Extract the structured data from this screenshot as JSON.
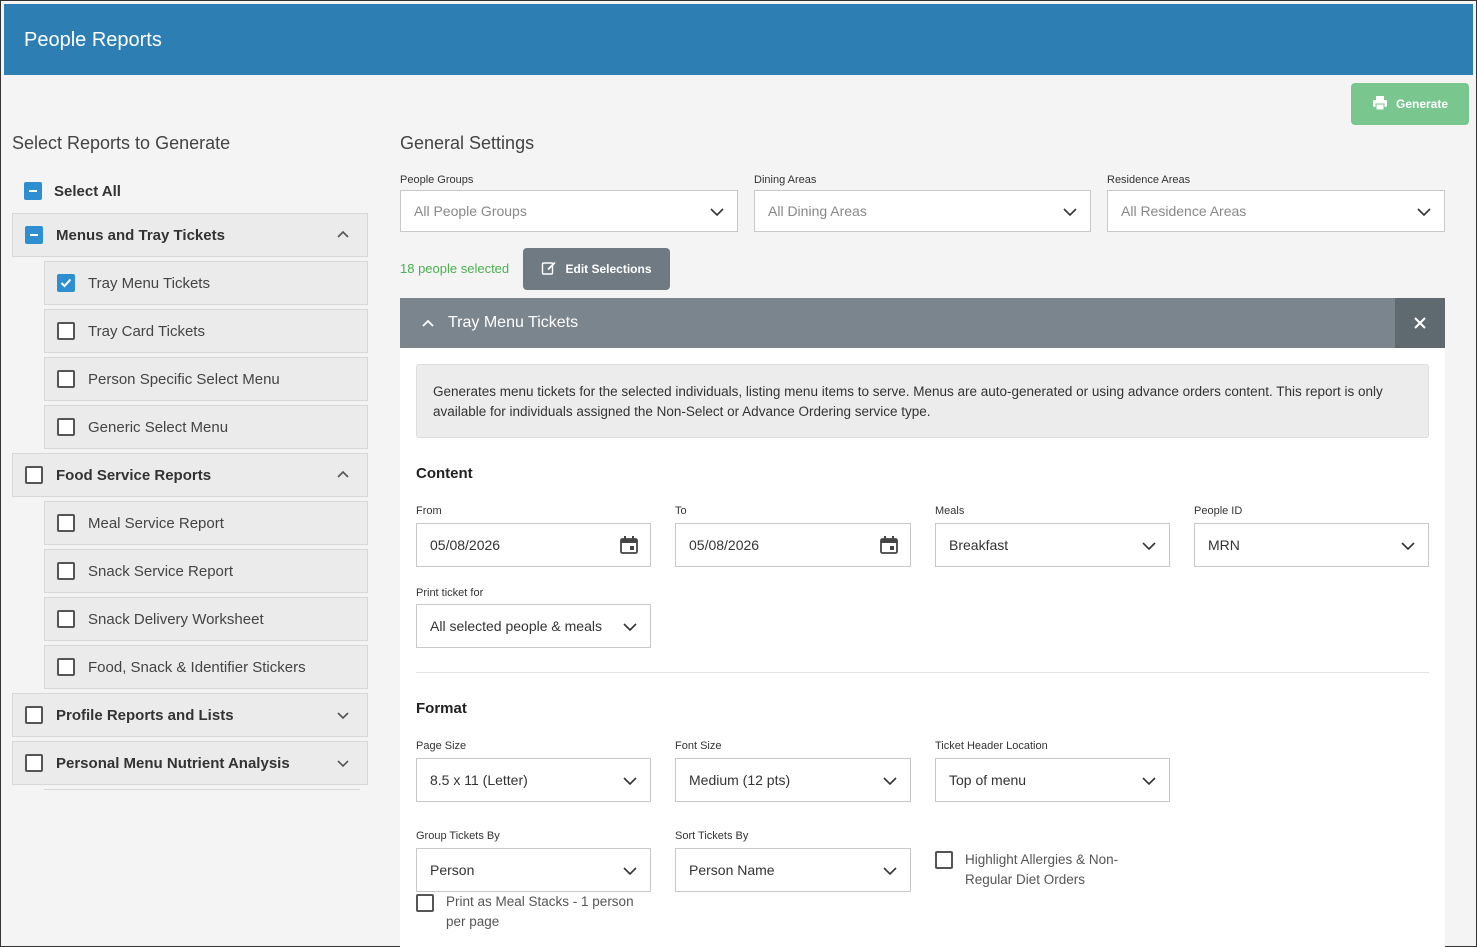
{
  "header": {
    "title": "People Reports"
  },
  "generate_label": "Generate",
  "left": {
    "heading": "Select Reports to Generate",
    "select_all": "Select All",
    "groups": [
      {
        "label": "Menus and Tray Tickets",
        "state": "partial",
        "expanded": true,
        "items": [
          {
            "label": "Tray Menu Tickets",
            "checked": true
          },
          {
            "label": "Tray Card Tickets",
            "checked": false
          },
          {
            "label": "Person Specific Select Menu",
            "checked": false
          },
          {
            "label": "Generic Select Menu",
            "checked": false
          }
        ]
      },
      {
        "label": "Food Service Reports",
        "state": "unchecked",
        "expanded": true,
        "items": [
          {
            "label": "Meal Service Report",
            "checked": false
          },
          {
            "label": "Snack Service Report",
            "checked": false
          },
          {
            "label": "Snack Delivery Worksheet",
            "checked": false
          },
          {
            "label": "Food, Snack & Identifier Stickers",
            "checked": false
          }
        ]
      },
      {
        "label": "Profile Reports and Lists",
        "state": "unchecked",
        "expanded": false,
        "items": []
      },
      {
        "label": "Personal Menu Nutrient Analysis",
        "state": "unchecked",
        "expanded": false,
        "items": []
      }
    ]
  },
  "general": {
    "heading": "General Settings",
    "people_groups": {
      "label": "People Groups",
      "value": "All People Groups"
    },
    "dining_areas": {
      "label": "Dining Areas",
      "value": "All Dining Areas"
    },
    "residence_areas": {
      "label": "Residence Areas",
      "value": "All Residence Areas"
    },
    "people_selected": "18 people selected",
    "edit_selections": "Edit Selections"
  },
  "panel": {
    "title": "Tray Menu Tickets",
    "description": "Generates menu tickets for the selected individuals, listing menu items to serve. Menus are auto-generated or using advance orders content. This report is only available for individuals assigned the Non-Select or Advance Ordering service type.",
    "content": {
      "heading": "Content",
      "from": {
        "label": "From",
        "value": "05/08/2026"
      },
      "to": {
        "label": "To",
        "value": "05/08/2026"
      },
      "meals": {
        "label": "Meals",
        "value": "Breakfast"
      },
      "people_id": {
        "label": "People ID",
        "value": "MRN"
      },
      "print_for": {
        "label": "Print ticket for",
        "value": "All selected people & meals"
      }
    },
    "format": {
      "heading": "Format",
      "page_size": {
        "label": "Page Size",
        "value": "8.5 x 11 (Letter)"
      },
      "font_size": {
        "label": "Font Size",
        "value": "Medium (12 pts)"
      },
      "header_location": {
        "label": "Ticket Header Location",
        "value": "Top of menu"
      },
      "group_by": {
        "label": "Group Tickets By",
        "value": "Person"
      },
      "sort_by": {
        "label": "Sort Tickets By",
        "value": "Person Name"
      },
      "highlight": {
        "label": "Highlight Allergies & Non-Regular Diet Orders",
        "checked": false
      },
      "meal_stacks": {
        "label": "Print as Meal Stacks - 1 person per page",
        "checked": false
      }
    }
  },
  "colors": {
    "header": "#2d7fb3",
    "generate": "#79c68f",
    "check": "#2d8fd0",
    "panel_head": "#7b858d"
  }
}
